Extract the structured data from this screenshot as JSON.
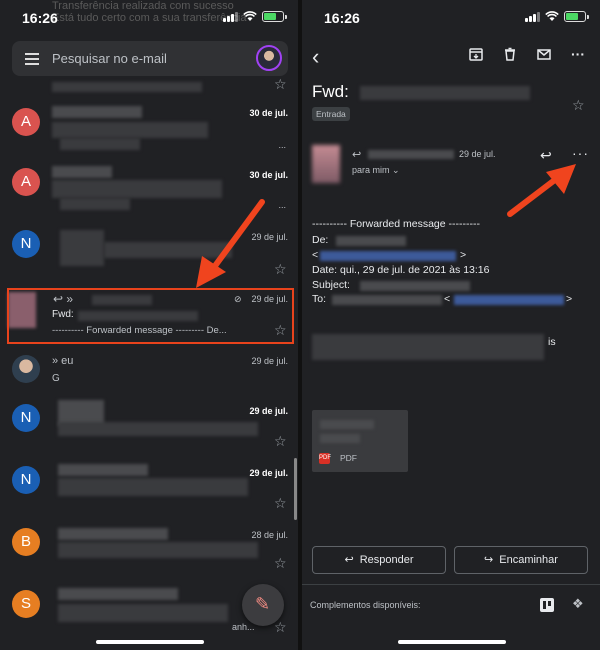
{
  "left": {
    "status_time": "16:26",
    "notification_ghost": [
      "Transferência realizada com sucesso",
      "Está tudo certo com a sua transferência"
    ],
    "search_placeholder": "Pesquisar no e-mail",
    "rows": [
      {
        "avatar": "A",
        "avatar_color": "#d9534f",
        "date": "30 de jul.",
        "bold": true,
        "snippet_tail": "..."
      },
      {
        "avatar": "A",
        "avatar_color": "#d9534f",
        "date": "30 de jul.",
        "bold": true,
        "snippet_tail": "..."
      },
      {
        "avatar": "N",
        "avatar_color": "#1a5fb4",
        "date": "29 de jul.",
        "bold": false,
        "snippet_tail": ""
      },
      {
        "avatar": "N",
        "avatar_color": "#1a5fb4",
        "date": "29 de jul.",
        "bold": true,
        "snippet_tail": ""
      },
      {
        "avatar": "N",
        "avatar_color": "#1a5fb4",
        "date": "29 de jul.",
        "bold": true,
        "snippet_tail": ""
      },
      {
        "avatar": "B",
        "avatar_color": "#e67e22",
        "date": "28 de jul.",
        "bold": false,
        "snippet_tail": ""
      },
      {
        "avatar": "S",
        "avatar_color": "#e67e22",
        "date": "",
        "bold": false,
        "snippet_tail": "anh..."
      }
    ],
    "highlighted": {
      "from_prefix": "»",
      "date": "29 de jul.",
      "subject": "Fwd:",
      "snippet": "---------- Forwarded message --------- De..."
    },
    "eu_row": {
      "from": "» eu",
      "date": "29 de jul.",
      "snippet": "G"
    }
  },
  "right": {
    "status_time": "16:26",
    "subject_prefix": "Fwd:",
    "label": "Entrada",
    "sender_date": "29 de jul.",
    "to_me": "para mim",
    "forward_header": "---------- Forwarded message ---------",
    "from_label": "De:",
    "date_line": "Date: qui., 29 de jul. de 2021 às 13:16",
    "subject_label": "Subject:",
    "to_label": "To:",
    "body_tail": "is",
    "attachment_type": "PDF",
    "reply_label": "Responder",
    "forward_label": "Encaminhar",
    "addons_label": "Complementos disponíveis:"
  },
  "colors": {
    "highlight": "#e8431c",
    "background": "#202124"
  }
}
